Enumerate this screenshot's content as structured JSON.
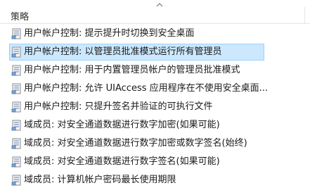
{
  "header": {
    "column_label": "策略"
  },
  "policies": [
    {
      "label": "用户帐户控制: 提示提升时切换到安全桌面",
      "selected": false
    },
    {
      "label": "用户帐户控制: 以管理员批准模式运行所有管理员",
      "selected": true
    },
    {
      "label": "用户帐户控制: 用于内置管理员帐户的管理员批准模式",
      "selected": false
    },
    {
      "label": "用户帐户控制: 允许 UIAccess 应用程序在不使用安全桌面...",
      "selected": false
    },
    {
      "label": "用户帐户控制: 只提升签名并验证的可执行文件",
      "selected": false
    },
    {
      "label": "域成员: 对安全通道数据进行数字加密(如果可能)",
      "selected": false
    },
    {
      "label": "域成员: 对安全通道数据进行数字加密或数字签名(始终)",
      "selected": false
    },
    {
      "label": "域成员: 对安全通道数据进行数字签名(如果可能)",
      "selected": false
    },
    {
      "label": "域成员: 计算机帐户密码最长使用期限",
      "selected": false
    }
  ],
  "colors": {
    "selection_bg": "#cce8ff",
    "selection_border": "#99d1ff",
    "icon_accent": "#5a7fb5"
  },
  "icons": {
    "row_icon": "policy-icon",
    "sort": "sort-ascending-icon"
  }
}
